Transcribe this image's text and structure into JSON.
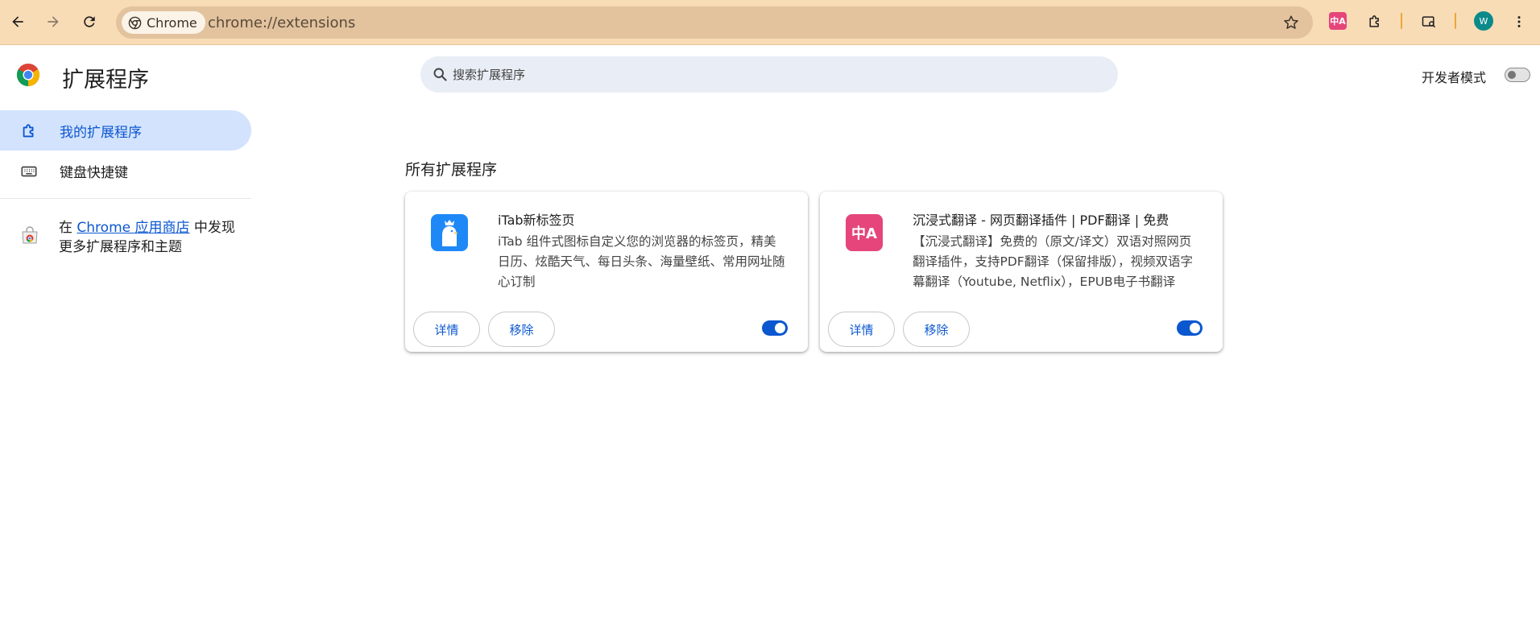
{
  "browser": {
    "chip_label": "Chrome",
    "url": "chrome://extensions",
    "avatar_initial": "W",
    "extension_badge": "中A"
  },
  "header": {
    "title": "扩展程序",
    "search_placeholder": "搜索扩展程序",
    "dev_mode_label": "开发者模式",
    "dev_mode_on": false
  },
  "sidebar": {
    "items": [
      {
        "label": "我的扩展程序",
        "icon": "extension-icon",
        "active": true
      },
      {
        "label": "键盘快捷键",
        "icon": "keyboard-icon",
        "active": false
      }
    ],
    "store_prefix": "在 ",
    "store_link": "Chrome 应用商店",
    "store_suffix": " 中发现更多扩展程序和主题"
  },
  "main": {
    "section_title": "所有扩展程序",
    "extensions": [
      {
        "name": "iTab新标签页",
        "description": "iTab 组件式图标自定义您的浏览器的标签页，精美日历、炫酷天气、每日头条、海量壁纸、常用网址随心订制",
        "details_label": "详情",
        "remove_label": "移除",
        "enabled": true,
        "icon_color": "#1e88f7"
      },
      {
        "name": "沉浸式翻译 - 网页翻译插件 | PDF翻译 | 免费",
        "description": "【沉浸式翻译】免费的（原文/译文）双语对照网页翻译插件，支持PDF翻译（保留排版），视频双语字幕翻译（Youtube, Netflix），EPUB电子书翻译",
        "details_label": "详情",
        "remove_label": "移除",
        "enabled": true,
        "icon_color": "#e5457a",
        "icon_text": "中A"
      }
    ]
  }
}
